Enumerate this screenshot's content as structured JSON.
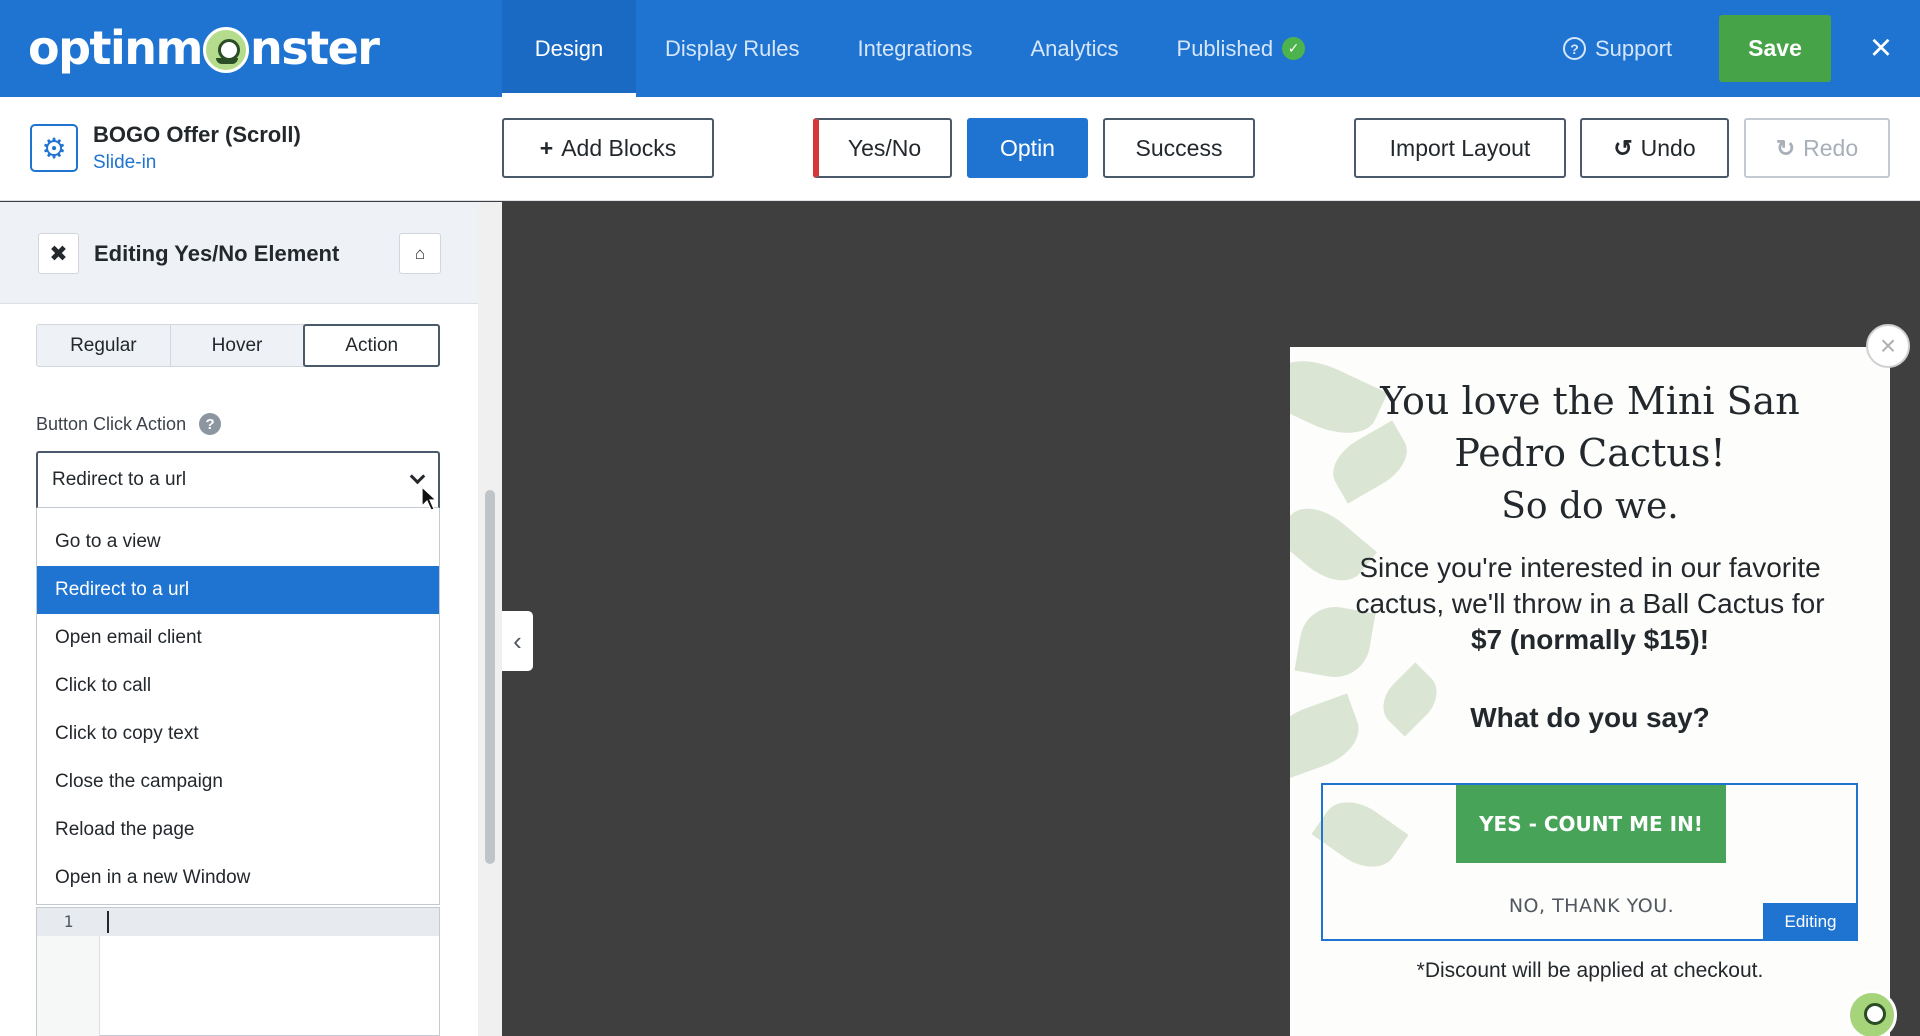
{
  "app": {
    "logo_text_a": "optinm",
    "logo_text_b": "nster",
    "brand_color": "#1f74d1",
    "save_color": "#47a347"
  },
  "nav": {
    "items": [
      {
        "label": "Design",
        "active": true
      },
      {
        "label": "Display Rules",
        "active": false
      },
      {
        "label": "Integrations",
        "active": false
      },
      {
        "label": "Analytics",
        "active": false
      },
      {
        "label": "Published",
        "active": false,
        "icon": "check-circle-icon"
      }
    ],
    "support_label": "Support",
    "save_label": "Save",
    "close_icon": "close-icon"
  },
  "campaign": {
    "name": "BOGO Offer (Scroll)",
    "type": "Slide-in"
  },
  "toolbar": {
    "add_blocks": "Add Blocks",
    "views": [
      "Yes/No",
      "Optin",
      "Success"
    ],
    "active_view": "Optin",
    "import_layout": "Import Layout",
    "undo": "Undo",
    "redo": "Redo"
  },
  "panel": {
    "title": "Editing Yes/No Element",
    "tabs": [
      "Regular",
      "Hover",
      "Action"
    ],
    "active_tab": "Action",
    "field_label": "Button Click Action",
    "select_value": "Redirect to a url",
    "options": [
      "Go to a view",
      "Redirect to a url",
      "Open email client",
      "Click to call",
      "Click to copy text",
      "Close the campaign",
      "Reload the page",
      "Open in a new Window"
    ],
    "selected_option": "Redirect to a url",
    "code_line_number": "1"
  },
  "popup": {
    "title": "You love the Mini San Pedro Cactus!",
    "subtitle": "So do we.",
    "body": "Since you're interested in our favorite cactus, we'll throw in a Ball Cactus for",
    "price": "$7 (normally $15)!",
    "question": "What do you say?",
    "yes_label": "YES - COUNT ME IN!",
    "no_label": "NO, THANK YOU.",
    "editing_tag": "Editing",
    "footnote": "*Discount will be applied at checkout.",
    "button_color": "#47a358"
  }
}
